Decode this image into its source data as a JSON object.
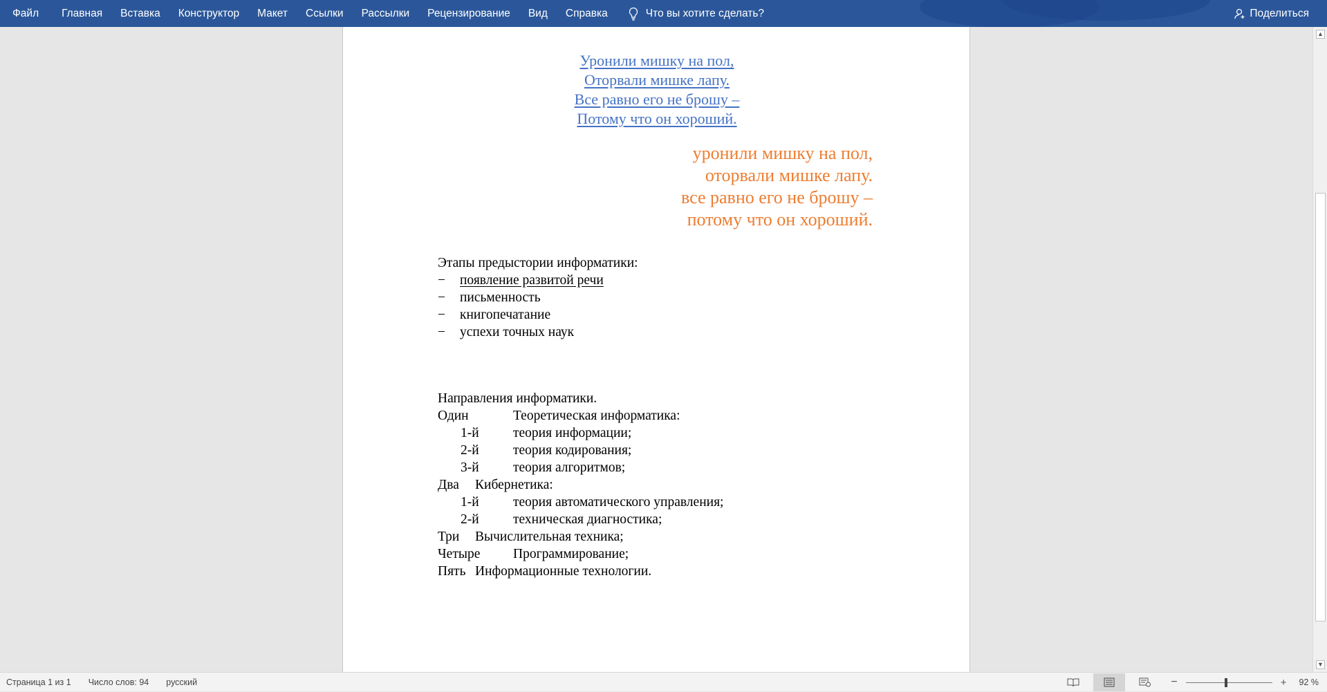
{
  "ribbon": {
    "tabs": [
      "Файл",
      "Главная",
      "Вставка",
      "Конструктор",
      "Макет",
      "Ссылки",
      "Рассылки",
      "Рецензирование",
      "Вид",
      "Справка"
    ],
    "tell_me": "Что вы хотите сделать?",
    "share": "Поделиться",
    "color": "#2b579a"
  },
  "document": {
    "blue_poem": [
      "Уронили мишку на пол,",
      "Оторвали мишке лапу.",
      "Все равно его не брошу –",
      "Потому что он хороший."
    ],
    "orange_poem": [
      "уронили мишку на пол,",
      "оторвали мишке лапу.",
      "все равно его не брошу –",
      "потому что он хороший."
    ],
    "stages_title": "Этапы предыстории информатики:",
    "stages": [
      "появление развитой речи",
      "письменность",
      "книгопечатание",
      "успехи точных наук"
    ],
    "list_dash": "−",
    "directions_title": "Направления информатики.",
    "directions": [
      {
        "num": "Один",
        "text": "Теоретическая информатика:"
      },
      {
        "num": "1-й",
        "text": "теория информации;",
        "sub": true
      },
      {
        "num": "2-й",
        "text": "теория кодирования;",
        "sub": true
      },
      {
        "num": "3-й",
        "text": "теория алгоритмов;",
        "sub": true
      },
      {
        "num": "Два",
        "text": "Кибернетика:",
        "short": true
      },
      {
        "num": "1-й",
        "text": "теория автоматического управления;",
        "sub": true
      },
      {
        "num": "2-й",
        "text": "техническая диагностика;",
        "sub": true
      },
      {
        "num": "Три",
        "text": "Вычислительная техника;",
        "short": true
      },
      {
        "num": "Четыре",
        "text": "Программирование;"
      },
      {
        "num": "Пять",
        "text": "Информационные технологии.",
        "short": true
      }
    ],
    "blue_color": "#4472c4",
    "orange_color": "#ed7d31"
  },
  "status": {
    "page": "Страница 1 из 1",
    "words": "Число слов: 94",
    "language": "русский",
    "zoom": "92 %"
  }
}
